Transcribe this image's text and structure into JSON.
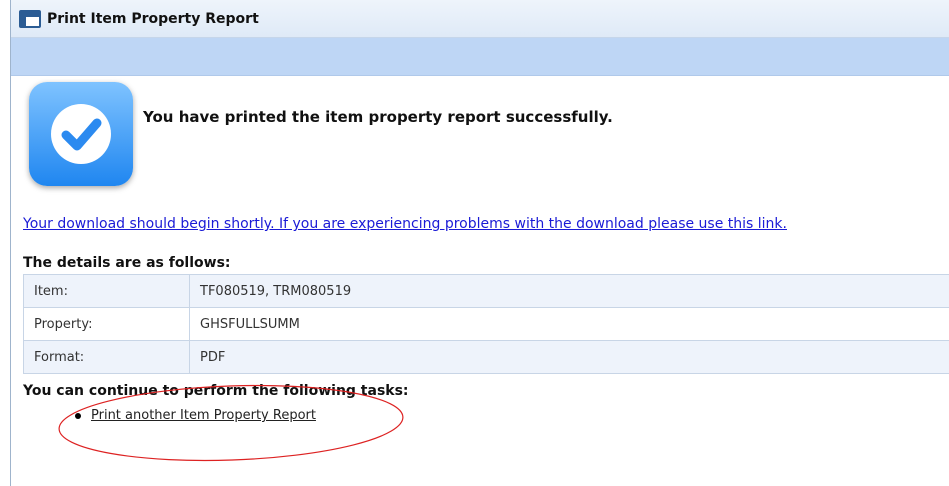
{
  "window": {
    "title": "Print Item Property Report"
  },
  "success": {
    "message": "You have printed the item property report successfully."
  },
  "download": {
    "link_text": "Your download should begin shortly. If you are experiencing problems with the download please use this link."
  },
  "details": {
    "heading": "The details are as follows:",
    "rows": [
      {
        "label": "Item:",
        "value": "TF080519, TRM080519"
      },
      {
        "label": "Property:",
        "value": "GHSFULLSUMM"
      },
      {
        "label": "Format:",
        "value": "PDF"
      }
    ]
  },
  "tasks": {
    "heading": "You can continue to perform the following tasks:",
    "items": [
      {
        "label": "Print another Item Property Report"
      }
    ]
  },
  "colors": {
    "link": "#1a1ad6",
    "title_bar": "#dfeaf7",
    "blue_bar": "#bed6f5",
    "annotation": "#d22"
  }
}
